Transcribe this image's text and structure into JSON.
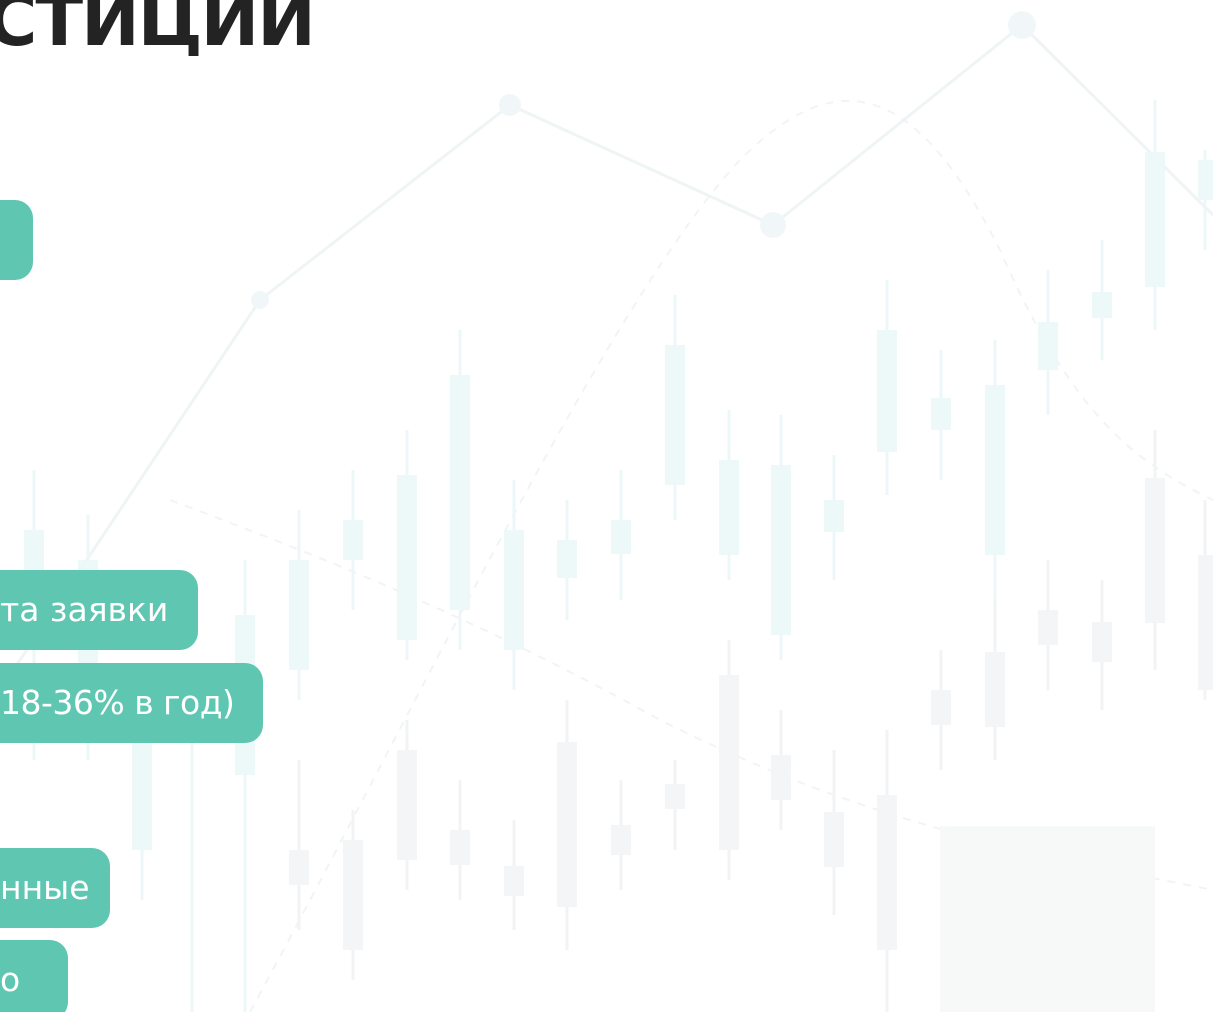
{
  "title": "СТИЦИИ",
  "accent_color": "#5fc7b1",
  "pills": [
    {
      "label": ""
    },
    {
      "label": "та заявки"
    },
    {
      "label": "18-36% в год)"
    },
    {
      "label": "нные"
    },
    {
      "label": "о"
    }
  ],
  "decor_icon": "market-candlestick-background"
}
